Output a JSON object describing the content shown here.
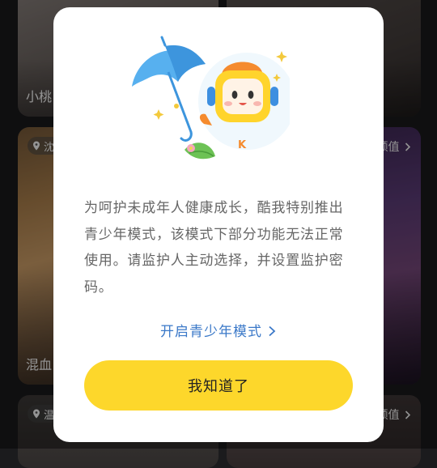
{
  "feed": {
    "cards": [
      {
        "name": "小桃",
        "location": "",
        "tag": ""
      },
      {
        "name": "",
        "location": "",
        "tag": ""
      },
      {
        "name": "混血",
        "location": "沈",
        "tag": ""
      },
      {
        "name": "",
        "location": "",
        "tag": "颜值"
      },
      {
        "name": "",
        "location": "温",
        "tag": ""
      },
      {
        "name": "",
        "location": "",
        "tag": "颜值"
      }
    ]
  },
  "modal": {
    "illustration": "teen-mode-mascot-with-umbrella",
    "description": "为呵护未成年人健康成长，酷我特别推出青少年模式，该模式下部分功能无法正常使用。请监护人主动选择，并设置监护密码。",
    "teen_mode_link": "开启青少年模式",
    "confirm_label": "我知道了"
  },
  "colors": {
    "accent": "#fdd72b",
    "link": "#3a78c8",
    "text": "#666666"
  },
  "icons": [
    "umbrella-icon",
    "mascot-robot-icon",
    "chevron-right-icon",
    "location-pin-icon"
  ]
}
